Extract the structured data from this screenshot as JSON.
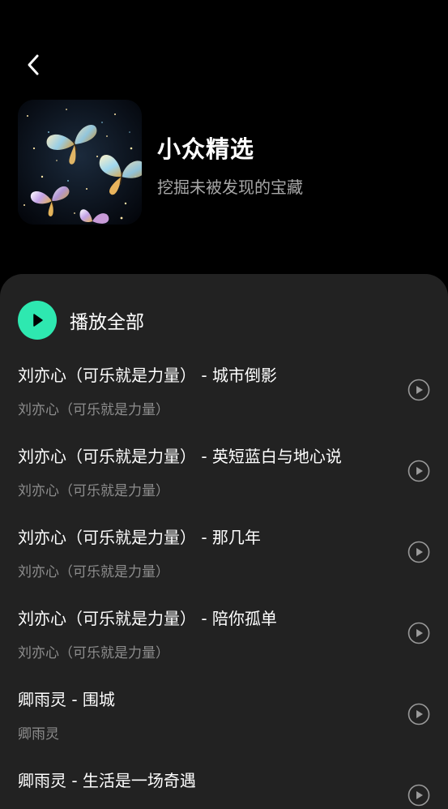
{
  "header": {
    "back_icon": "chevron-left-icon",
    "title": "小众精选",
    "subtitle": "挖掘未被发现的宝藏"
  },
  "play_all": {
    "label": "播放全部",
    "icon": "play-icon",
    "accent_color": "#2ee8b0"
  },
  "songs": [
    {
      "title": "刘亦心（可乐就是力量） - 城市倒影",
      "artist": "刘亦心（可乐就是力量）"
    },
    {
      "title": "刘亦心（可乐就是力量） - 英短蓝白与地心说",
      "artist": "刘亦心（可乐就是力量）"
    },
    {
      "title": "刘亦心（可乐就是力量） - 那几年",
      "artist": "刘亦心（可乐就是力量）"
    },
    {
      "title": "刘亦心（可乐就是力量） - 陪你孤单",
      "artist": "刘亦心（可乐就是力量）"
    },
    {
      "title": "卿雨灵 - 围城",
      "artist": "卿雨灵"
    },
    {
      "title": "卿雨灵 - 生活是一场奇遇",
      "artist": ""
    }
  ],
  "colors": {
    "background": "#000000",
    "panel": "#222222",
    "secondary_text": "#8d8d8d"
  }
}
